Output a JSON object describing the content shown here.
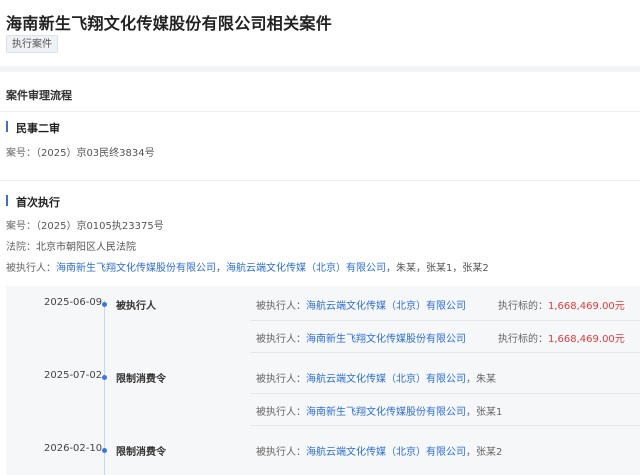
{
  "title": "海南新生飞翔文化传媒股份有限公司相关案件",
  "tag": "执行案件",
  "section_title": "案件审理流程",
  "civil": {
    "heading": "民事二审",
    "case_label": "案号：",
    "case_no": "（2025）京03民终3834号"
  },
  "execution": {
    "heading": "首次执行",
    "case_label": "案号：",
    "case_no": "（2025）京0105执23375号",
    "court_label": "法院：",
    "court": "北京市朝阳区人民法院",
    "party_label": "被执行人：",
    "party_link1": "海南新生飞翔文化传媒股份有限公司",
    "sep1": "，",
    "party_link2": "海航云端文化传媒（北京）有限公司",
    "party_rest": "，朱某，张某1，张某2"
  },
  "timeline": [
    {
      "date": "2025-06-09",
      "type": "被执行人",
      "rows": [
        {
          "label": "被执行人：",
          "link": "海航云端文化传媒（北京）有限公司",
          "rest": "",
          "amount_label": "执行标的：",
          "amount": "1,668,469.00元"
        },
        {
          "label": "被执行人：",
          "link": "海南新生飞翔文化传媒股份有限公司",
          "rest": "",
          "amount_label": "执行标的：",
          "amount": "1,668,469.00元"
        }
      ]
    },
    {
      "date": "2025-07-02",
      "type": "限制消费令",
      "rows": [
        {
          "label": "被执行人：",
          "link": "海航云端文化传媒（北京）有限公司",
          "rest": "，朱某"
        },
        {
          "label": "被执行人：",
          "link": "海南新生飞翔文化传媒股份有限公司",
          "rest": "，张某1"
        }
      ]
    },
    {
      "date": "2026-02-10",
      "type": "限制消费令",
      "rows": [
        {
          "label": "被执行人：",
          "link": "海航云端文化传媒（北京）有限公司",
          "rest": "，张某2"
        }
      ]
    }
  ]
}
